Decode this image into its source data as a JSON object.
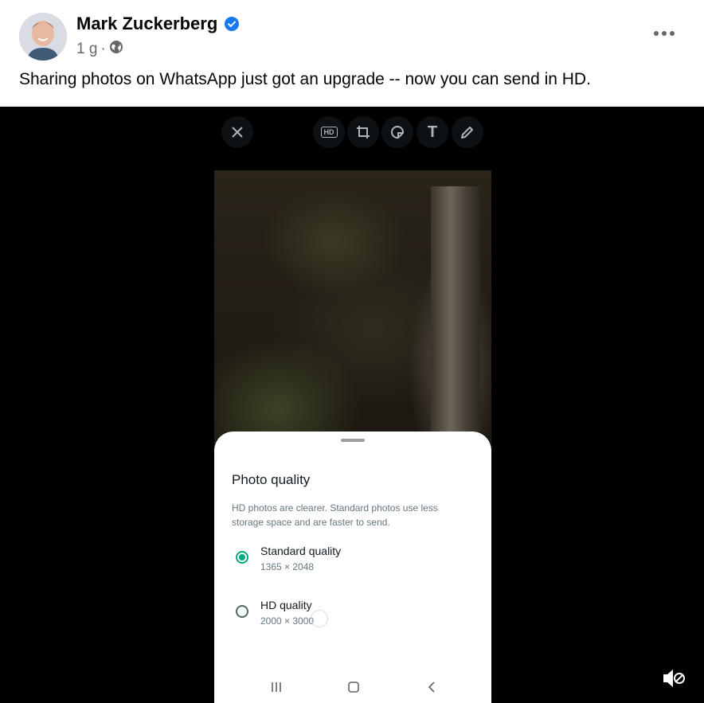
{
  "post": {
    "author": "Mark Zuckerberg",
    "time": "1 g",
    "separator": "·",
    "text": "Sharing photos on WhatsApp just got an upgrade -- now you can send in HD."
  },
  "editor": {
    "toolbar": {
      "close_icon": "close-icon",
      "hd_label": "HD",
      "text_label": "T"
    }
  },
  "sheet": {
    "title": "Photo quality",
    "description": "HD photos are clearer. Standard photos use less storage space and are faster to send.",
    "options": [
      {
        "label": "Standard quality",
        "resolution": "1365 × 2048",
        "selected": true
      },
      {
        "label": "HD quality",
        "resolution": "2000 × 3000",
        "selected": false
      }
    ]
  },
  "colors": {
    "accent": "#00a884",
    "verified": "#1877f2",
    "text": "#050505",
    "secondary_text": "#65676b"
  }
}
